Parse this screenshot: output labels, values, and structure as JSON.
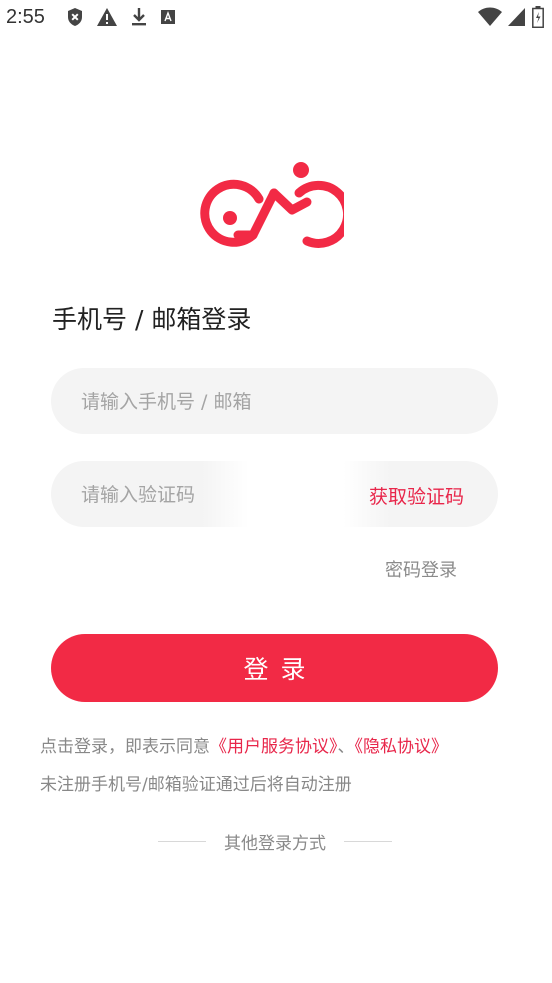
{
  "status_bar": {
    "time": "2:55",
    "left_icons": [
      "shield-x-icon",
      "warning-icon",
      "download-icon",
      "font-icon"
    ],
    "right_icons": [
      "wifi-icon",
      "signal-icon",
      "battery-icon"
    ]
  },
  "brand": {
    "logo": "bicycle-logo-icon",
    "color": "#f22a45"
  },
  "title": "手机号 / 邮箱登录",
  "phone_field": {
    "placeholder": "请输入手机号 / 邮箱",
    "value": ""
  },
  "code_field": {
    "placeholder": "请输入验证码",
    "value": ""
  },
  "get_code_label": "获取验证码",
  "password_login_label": "密码登录",
  "login_button_label": "登录",
  "agreement": {
    "prefix": "点击登录，即表示同意",
    "user_service": "《用户服务协议》",
    "separator": "、",
    "privacy": "《隐私协议》",
    "note": "未注册手机号/邮箱验证通过后将自动注册"
  },
  "other_login_label": "其他登录方式"
}
